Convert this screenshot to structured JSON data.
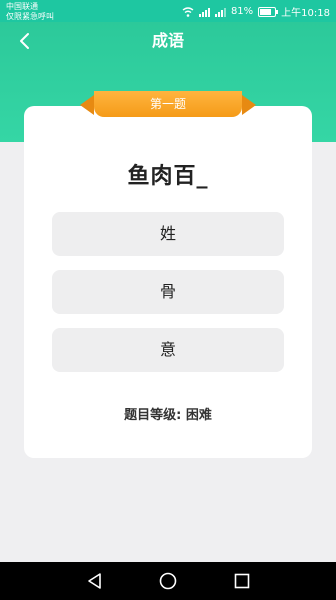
{
  "status_bar": {
    "carrier_line1": "中国联通",
    "carrier_line2": "仅限紧急呼叫",
    "battery": "81%",
    "time": "上午10:18"
  },
  "header": {
    "title": "成语",
    "back_icon": "chevron-left-icon"
  },
  "quiz": {
    "badge": "第一题",
    "question": "鱼肉百_",
    "options": [
      "姓",
      "骨",
      "意"
    ],
    "level": "题目等级: 困难"
  },
  "nav": {
    "back_icon": "triangle-back-icon",
    "home_icon": "circle-home-icon",
    "recent_icon": "square-recents-icon"
  },
  "colors": {
    "header": "#2cc99a",
    "badge": "#f5a21f",
    "background": "#efeff1",
    "option_bg": "#eeeeef"
  }
}
